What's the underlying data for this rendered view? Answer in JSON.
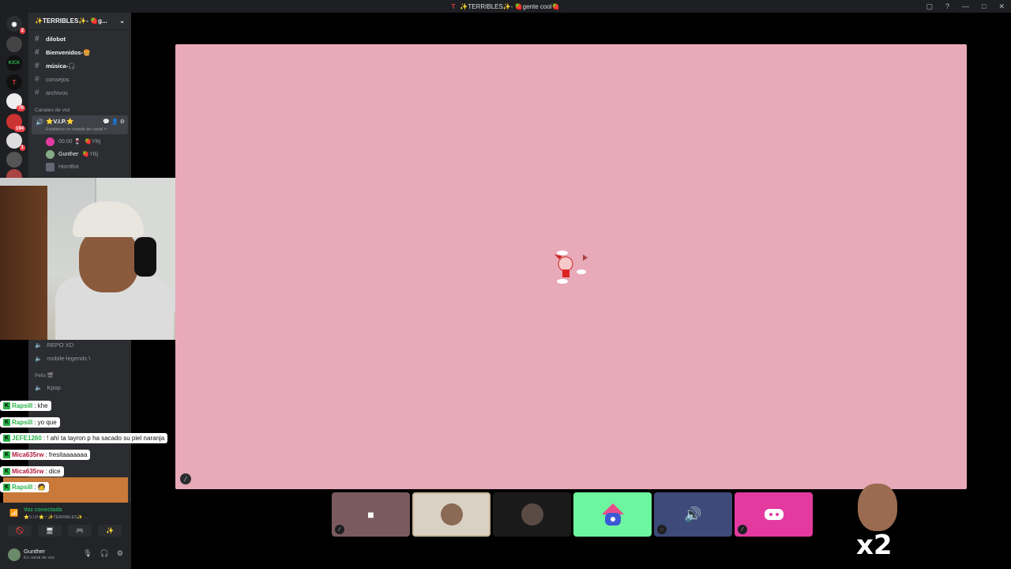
{
  "titlebar": {
    "logo": "T",
    "title": "✨TERRIBLES✨- 🍓gente cool🍓",
    "controls": [
      "▢",
      "?",
      "—",
      "□",
      "✕"
    ]
  },
  "servers": [
    {
      "icon": "discord-icon",
      "badge": "2"
    },
    {
      "icon": "server-icon",
      "badge": ""
    },
    {
      "icon": "kick-icon",
      "label": "KICK",
      "badge": ""
    },
    {
      "icon": "terribles-icon",
      "label": "T",
      "badge": ""
    },
    {
      "icon": "server-icon",
      "badge": "76"
    },
    {
      "icon": "server-icon",
      "badge": "194"
    },
    {
      "icon": "server-icon",
      "badge": "1"
    },
    {
      "icon": "server-icon",
      "badge": ""
    },
    {
      "icon": "server-icon",
      "badge": ""
    }
  ],
  "sidebar": {
    "server_name": "✨TERRIBLES✨- 🍓g...",
    "text_channels": [
      {
        "name": "dilobot",
        "bright": true
      },
      {
        "name": "Bienvenidos-🍔",
        "bright": true
      },
      {
        "name": "música-🎧",
        "bright": true
      },
      {
        "name": "consejos",
        "bright": false
      },
      {
        "name": "archivos",
        "bright": false
      }
    ],
    "voice_category": "Canales de voz",
    "active_voice": {
      "name": "⭐V.I.P.⭐",
      "status_hint": "Establece un estado de canal ✏"
    },
    "voice_users": [
      {
        "name": "00:00 🍷",
        "tag": "🍓Yltij"
      },
      {
        "name": "Gunther",
        "tag": "🍓Yltij"
      },
      {
        "name": "HornBot",
        "tag": ""
      }
    ],
    "more_voice": [
      "REPO XD",
      "mobile-legends \\"
    ],
    "pelis_category": "Pelis 🎬",
    "pelis_channels": [
      "Kpop"
    ]
  },
  "chat": [
    {
      "user": "Rapsill",
      "msg": " : khe",
      "style": "u1"
    },
    {
      "user": "Rapsill",
      "msg": " : yo que",
      "style": "u1"
    },
    {
      "user": "JEFE1260",
      "msg": " : ! ahí ta tayron p ha sacado su piel naranja",
      "style": "u1"
    },
    {
      "user": "Mica635rw",
      "msg": " : fresitaaaaaaa",
      "style": "u2"
    },
    {
      "user": "Mica635rw",
      "msg": " : dice",
      "style": "u2"
    },
    {
      "user": "Rapsill",
      "msg": " : 🧑",
      "style": "u1"
    }
  ],
  "voice_panel": {
    "status": "Voz conectada",
    "channel": "⭐V.I.P.⭐ / ✨TERRIBLES✨ ...",
    "buttons": [
      "🚫",
      "🖥",
      "🎮",
      "✨"
    ]
  },
  "user": {
    "name": "Gunther",
    "status": "En canal de voz"
  },
  "tiles": [
    {
      "name": "tile-1",
      "bg": "#7a5a5e",
      "muted": true
    },
    {
      "name": "tile-2",
      "bg": "#d9d2c4",
      "muted": false
    },
    {
      "name": "tile-3",
      "bg": "#1a1a1a",
      "muted": false
    },
    {
      "name": "tile-4",
      "bg": "#6ef5a0",
      "muted": false
    },
    {
      "name": "tile-5",
      "bg": "#3e4a7a",
      "muted": true
    },
    {
      "name": "tile-6",
      "bg": "#e43aa0",
      "muted": true
    }
  ],
  "overlay_text": "x2",
  "colors": {
    "stage": "#e8a9b8",
    "discord_blurple": "#5865f2",
    "kick_green": "#2bb24a"
  }
}
